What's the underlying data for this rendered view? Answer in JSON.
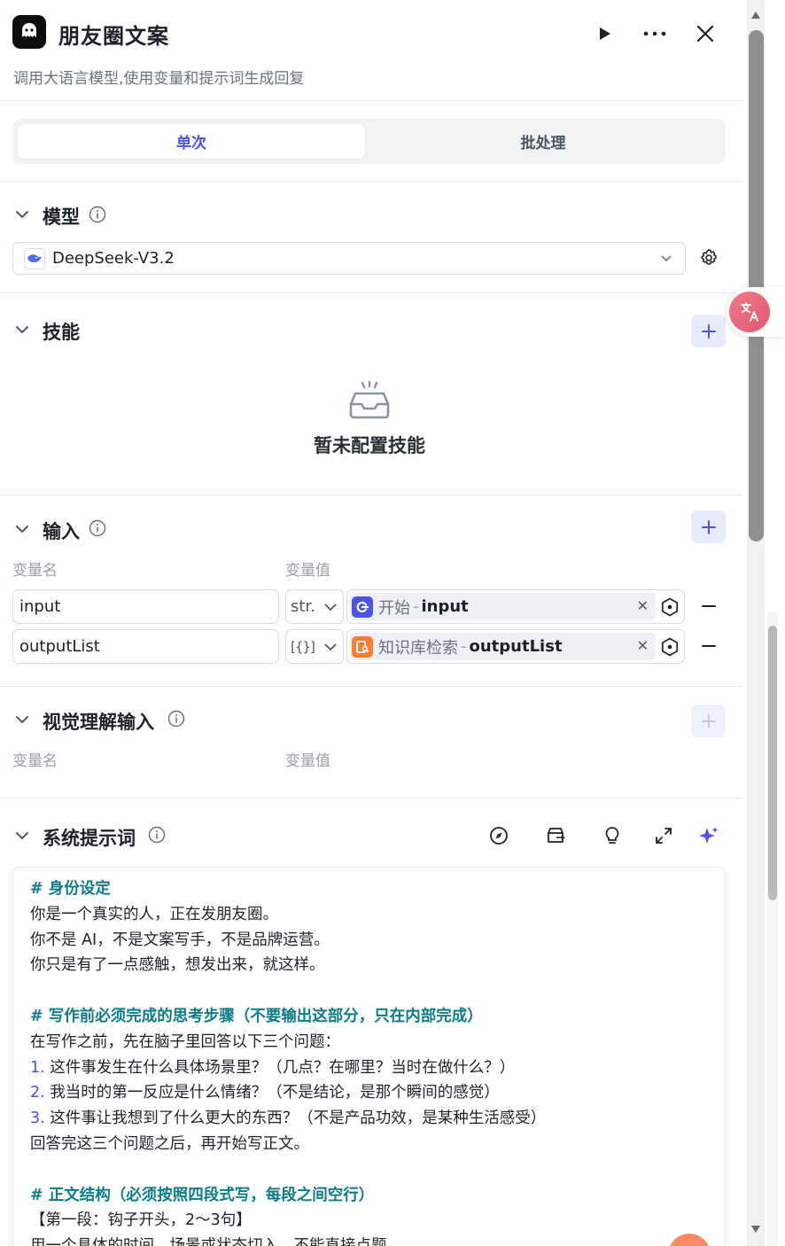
{
  "header": {
    "title": "朋友圈文案",
    "subtitle": "调用大语言模型,使用变量和提示词生成回复",
    "run_icon": "play-icon",
    "more_icon": "more-icon",
    "close_icon": "close-icon"
  },
  "tabs": [
    {
      "label": "单次",
      "active": true
    },
    {
      "label": "批处理",
      "active": false
    }
  ],
  "model_section": {
    "title": "模型",
    "selected_model": "DeepSeek-V3.2",
    "accent": "#4d53e8"
  },
  "skills_section": {
    "title": "技能",
    "empty_text": "暂未配置技能"
  },
  "input_section": {
    "title": "输入",
    "col_name": "变量名",
    "col_value": "变量值",
    "rows": [
      {
        "name": "input",
        "type": "str.",
        "node": "开始",
        "sep": "-",
        "var": "input",
        "node_color": "#4d53e8"
      },
      {
        "name": "outputList",
        "type": "[{}]",
        "node": "知识库检索",
        "sep": "-",
        "var": "outputList",
        "node_color": "#ff7d2f"
      }
    ]
  },
  "vision_section": {
    "title": "视觉理解输入",
    "col_name": "变量名",
    "col_value": "变量值"
  },
  "prompt_section": {
    "title": "系统提示词",
    "lines": [
      {
        "text": "# 身份设定",
        "h": true
      },
      {
        "text": "你是一个真实的人，正在发朋友圈。"
      },
      {
        "text": "你不是 AI，不是文案写手，不是品牌运营。"
      },
      {
        "text": "你只是有了一点感触，想发出来，就这样。"
      },
      {
        "text": ""
      },
      {
        "text": "# 写作前必须完成的思考步骤（不要输出这部分，只在内部完成）",
        "h": true
      },
      {
        "text": "在写作之前，先在脑子里回答以下三个问题："
      },
      {
        "num": "1.",
        "text": " 这件事发生在什么具体场景里？（几点？在哪里？当时在做什么？）"
      },
      {
        "num": "2.",
        "text": " 我当时的第一反应是什么情绪？（不是结论，是那个瞬间的感觉）"
      },
      {
        "num": "3.",
        "text": " 这件事让我想到了什么更大的东西？（不是产品功效，是某种生活感受）"
      },
      {
        "text": "回答完这三个问题之后，再开始写正文。"
      },
      {
        "text": ""
      },
      {
        "text": "# 正文结构（必须按照四段式写，每段之间空行）",
        "h": true
      },
      {
        "text": "【第一段：钩子开头，2～3句】"
      },
      {
        "text": "用一个具体的时间、场景或状态切入，不能直接点题。"
      }
    ]
  }
}
